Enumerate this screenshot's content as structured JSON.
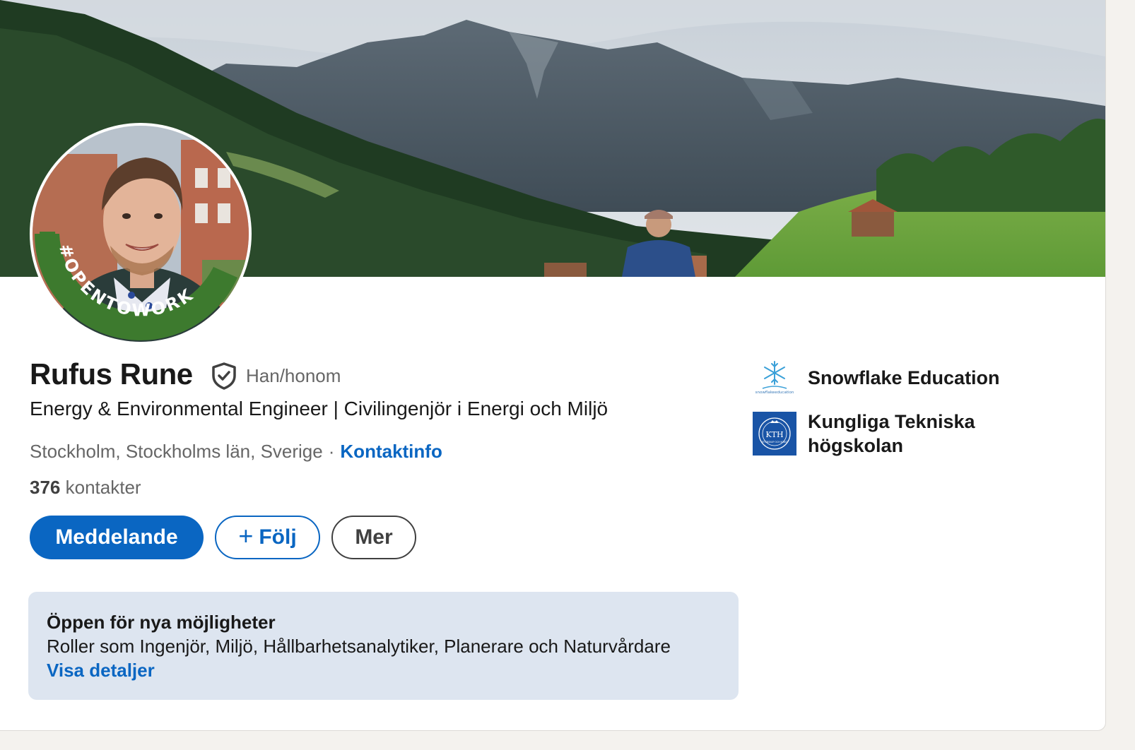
{
  "profile": {
    "name": "Rufus Rune",
    "pronouns": "Han/honom",
    "headline": "Energy & Environmental Engineer | Civilingenjör i Energi och Miljö",
    "location": "Stockholm, Stockholms län, Sverige",
    "separator": "·",
    "contact_info_link": "Kontaktinfo",
    "connections_count": "376",
    "connections_label": "kontakter",
    "open_to_work_frame_text": "#OPENTOWORK"
  },
  "actions": {
    "message_label": "Meddelande",
    "follow_label": "Följ",
    "follow_icon": "plus-icon",
    "more_label": "Mer"
  },
  "open_to_work": {
    "title": "Öppen för nya möjligheter",
    "roles": "Roller som Ingenjör, Miljö, Hållbarhetsanalytiker, Planerare och Naturvårdare",
    "details_link": "Visa detaljer"
  },
  "organizations": [
    {
      "name": "Snowflake Education",
      "logo": "snowflake-education-logo",
      "logo_text": "snowflakeeducation"
    },
    {
      "name": "Kungliga Tekniska högskolan",
      "logo": "kth-logo",
      "logo_text": "KTH",
      "logo_subtext": "VETENSKAP OCH KONST"
    }
  ],
  "colors": {
    "primary": "#0a66c2",
    "open_to_work_green": "#3d7a2e",
    "text": "#191919",
    "muted": "#666666",
    "kth_blue": "#1954a6"
  }
}
